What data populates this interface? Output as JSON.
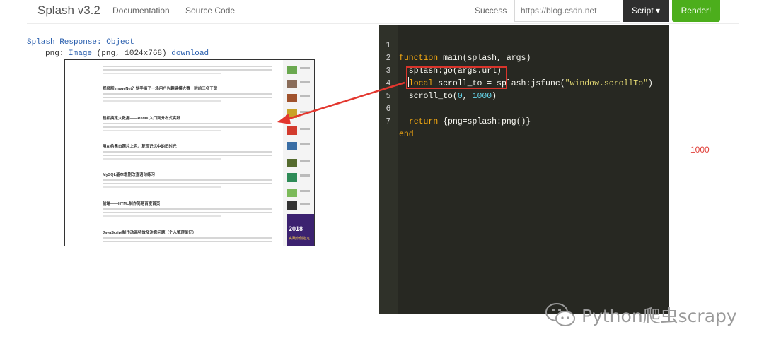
{
  "navbar": {
    "brand": "Splash v3.2",
    "links": [
      "Documentation",
      "Source Code"
    ],
    "status": "Success",
    "url_value": "https://blog.csdn.net",
    "script_label": "Script ▾",
    "render_label": "Render!"
  },
  "response": {
    "line1": "Splash Response: Object",
    "key": "png:",
    "type": "Image",
    "info": "(png, 1024x768)",
    "download": "download"
  },
  "thumbnail": {
    "articles": [
      "视频版ImageNet？快手搞了一场用户兴趣建模大赛｜附前三名干货",
      "轻松搞定大数据——Redis 入门到分布式实践",
      "用AI给黑白照片上色，复现记忆中的旧时光",
      "MySQL基本增删改查语句练习",
      "前端——HTML制作简易百度首页",
      "JavaScript制作动画特效及注意问题（个人整理笔记）"
    ],
    "banner_year": "2018",
    "banner_caption": "实践案例指定"
  },
  "editor": {
    "lines": [
      {
        "n": "1",
        "code": "function main(splash, args)"
      },
      {
        "n": "2",
        "code": "  splash:go(args.url)"
      },
      {
        "n": "3",
        "code": "  local scroll_to = splash:jsfunc(\"window.scrollTo\")"
      },
      {
        "n": "4",
        "code": "  scroll_to(0, 1000)"
      },
      {
        "n": "5",
        "code": ""
      },
      {
        "n": "6",
        "code": "  return {png=splash:png()}"
      },
      {
        "n": "7",
        "code": "end"
      }
    ]
  },
  "annotation": "1000",
  "watermark": "Python爬虫scrapy",
  "colors": {
    "accent_green": "#4cae1c",
    "editor_bg": "#272822",
    "annotation_red": "#e0403a"
  }
}
